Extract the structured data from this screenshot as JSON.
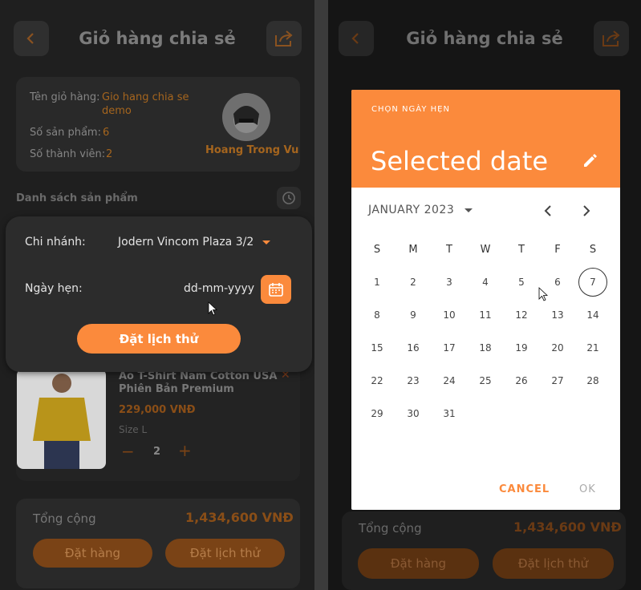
{
  "colors": {
    "accent": "#fb8a3c",
    "panel": "#1f1f1f",
    "card": "#292929",
    "dim_orange": "#a5651e"
  },
  "header": {
    "title": "Giỏ hàng chia sẻ",
    "back_icon": "chevron-left-icon",
    "share_icon": "share-icon"
  },
  "info": {
    "name_label": "Tên giỏ hàng:",
    "name_value_line1": "Gio hang chia se",
    "name_value_line2": "demo",
    "count_label": "Số sản phẩm:",
    "count_value": "6",
    "members_label": "Số thành viên:",
    "members_value": "2",
    "owner": "Hoang Trong Vu"
  },
  "list_title": "Danh sách sản phẩm",
  "sheet": {
    "branch_label": "Chi nhánh:",
    "branch_value": "Jodern Vincom Plaza 3/2",
    "date_label": "Ngày hẹn:",
    "date_placeholder": "dd-mm-yyyy",
    "submit": "Đặt lịch thử"
  },
  "product": {
    "name_line1": "Áo T-Shirt Nam Cotton USA",
    "name_line2": "Phiên Bản Premium",
    "price": "229,000 VNĐ",
    "size": "Size L",
    "qty": "2"
  },
  "total": {
    "label": "Tổng cộng",
    "value": "1,434,600 VNĐ"
  },
  "actions": {
    "order": "Đặt hàng",
    "book": "Đặt lịch thử"
  },
  "dialog": {
    "overline": "CHỌN NGÀY HẸN",
    "headline": "Selected date",
    "month": "JANUARY 2023",
    "weekdays": [
      "S",
      "M",
      "T",
      "W",
      "T",
      "F",
      "S"
    ],
    "days": [
      "1",
      "2",
      "3",
      "4",
      "5",
      "6",
      "7",
      "8",
      "9",
      "10",
      "11",
      "12",
      "13",
      "14",
      "15",
      "16",
      "17",
      "18",
      "19",
      "20",
      "21",
      "22",
      "23",
      "24",
      "25",
      "26",
      "27",
      "28",
      "29",
      "30",
      "31"
    ],
    "today": "7",
    "cancel": "CANCEL",
    "ok": "OK"
  }
}
